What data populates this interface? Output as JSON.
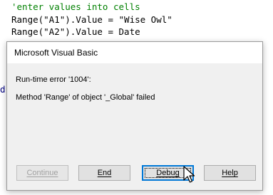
{
  "code": {
    "lines": [
      "'enter values into cells",
      "Range(\"A1\").Value = \"Wise Owl\"",
      "Range(\"A2\").Value = Date"
    ],
    "partial_left_glyph": "d"
  },
  "dialog": {
    "title": "Microsoft Visual Basic",
    "error_line": "Run-time error '1004':",
    "message": "Method 'Range' of object '_Global' failed",
    "buttons": {
      "continue": "Continue",
      "end": "End",
      "debug": "Debug",
      "help": "Help"
    }
  },
  "icons": {
    "cursor": "mouse-pointer-icon"
  }
}
